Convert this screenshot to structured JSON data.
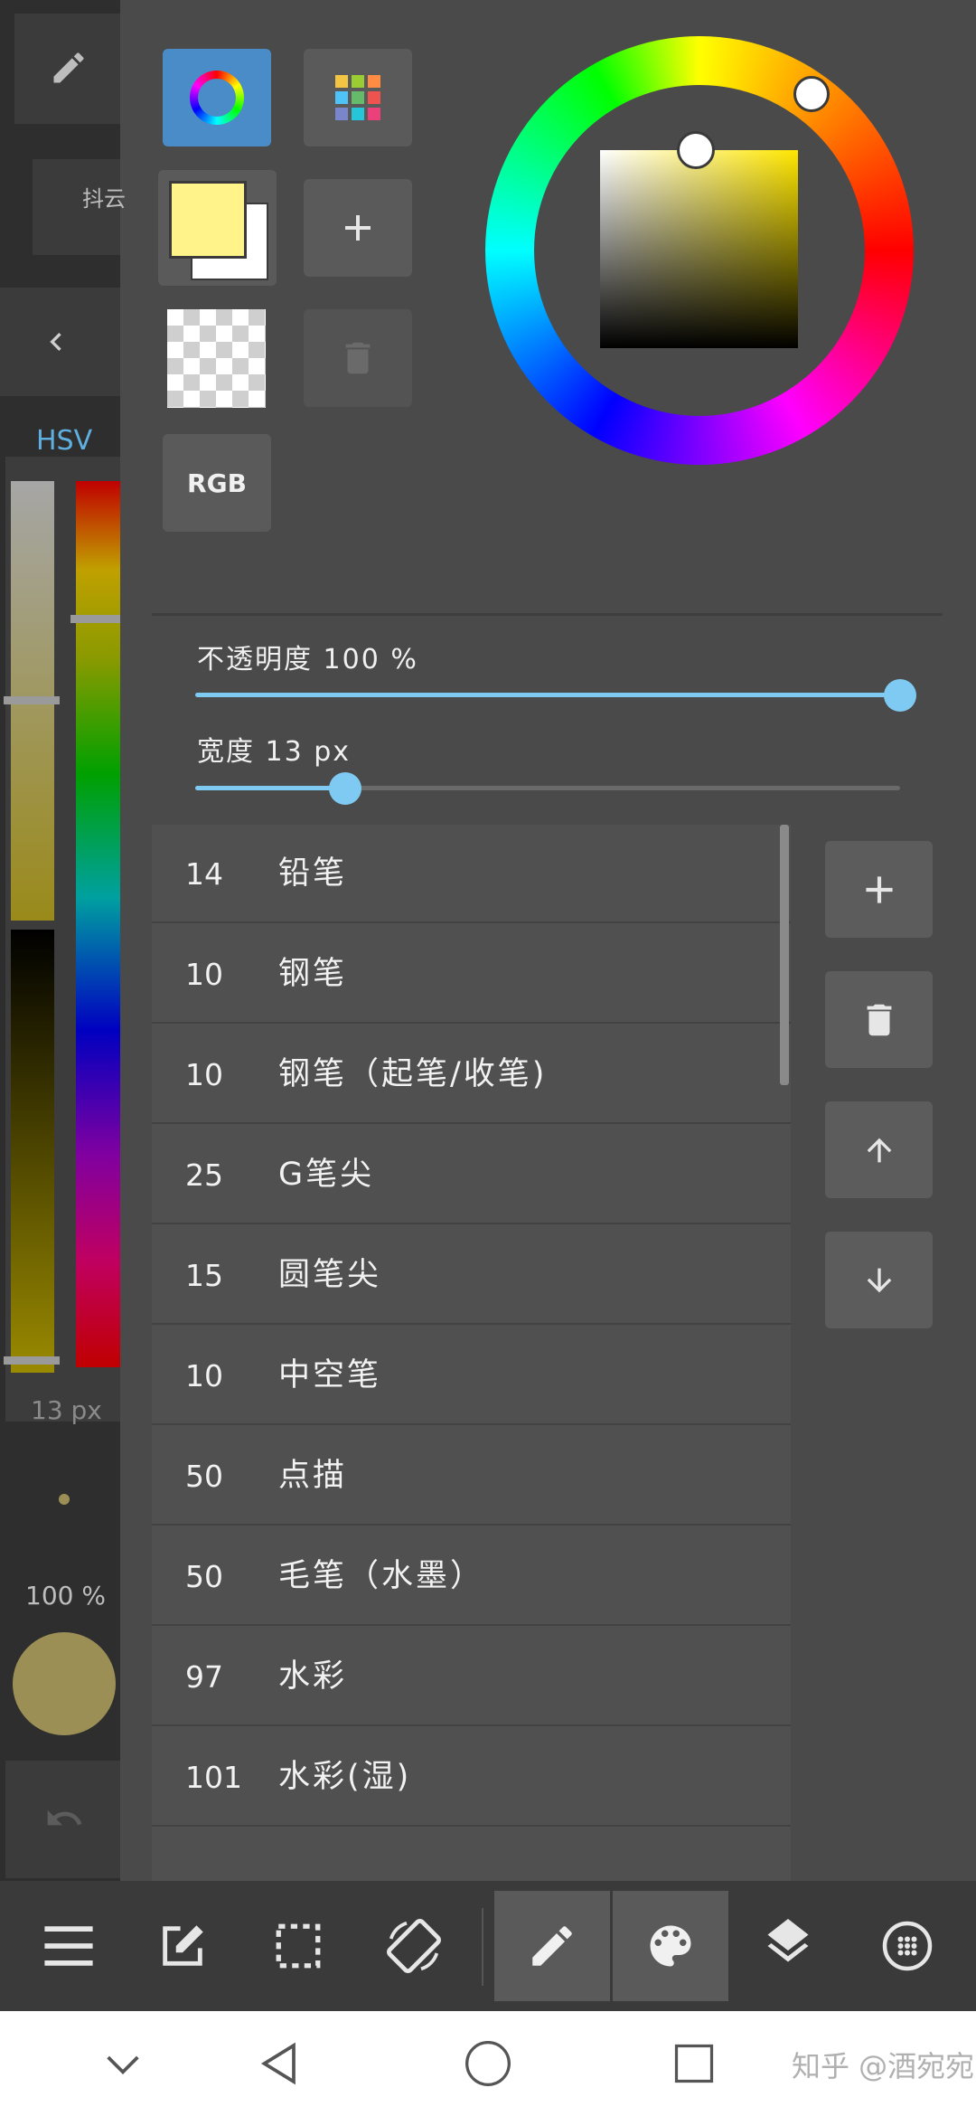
{
  "left_strip": {
    "tab_label": "抖云",
    "mode_label": "HSV",
    "size_readout": "13 px",
    "opacity_readout": "100 %",
    "current_color": "#9c8f55"
  },
  "color_picker": {
    "main_color": "#fff38a",
    "sub_color": "#ffffff",
    "rgb_label": "RGB",
    "hue_color": "#ffe600"
  },
  "opacity": {
    "label": "不透明度  100 %",
    "value": 100
  },
  "width": {
    "label": "宽度  13 px",
    "value": 13
  },
  "brushes": [
    {
      "size": "14",
      "name": "铅笔"
    },
    {
      "size": "10",
      "name": "钢笔"
    },
    {
      "size": "10",
      "name": "钢笔（起笔/收笔)"
    },
    {
      "size": "25",
      "name": "G笔尖"
    },
    {
      "size": "15",
      "name": "圆笔尖"
    },
    {
      "size": "10",
      "name": "中空笔"
    },
    {
      "size": "50",
      "name": "点描"
    },
    {
      "size": "50",
      "name": "毛笔（水墨）"
    },
    {
      "size": "97",
      "name": "水彩"
    },
    {
      "size": "101",
      "name": "水彩(湿)"
    }
  ],
  "watermark": "知乎 @酒宛宛",
  "accent": "#7fcaf2"
}
